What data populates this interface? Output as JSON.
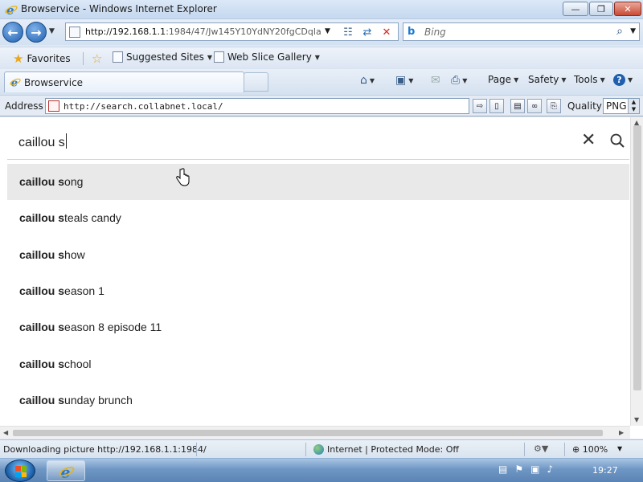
{
  "window": {
    "title": "Browservice - Windows Internet Explorer",
    "min_glyph": "—",
    "max_glyph": "❐",
    "close_glyph": "✕"
  },
  "nav": {
    "url_host": "http://192.168.1.1",
    "url_path": ":1984/47/Jw145Y10YdNY20fgCDqlakur",
    "search_placeholder": "Bing"
  },
  "favorites_bar": {
    "favorites_label": "Favorites",
    "suggested_label": "Suggested Sites",
    "webslice_label": "Web Slice Gallery"
  },
  "tab": {
    "label": "Browservice"
  },
  "commands": {
    "page": "Page",
    "safety": "Safety",
    "tools": "Tools"
  },
  "address": {
    "label": "Address",
    "value": "http://search.collabnet.local/",
    "quality_label": "Quality",
    "quality_value": "PNG"
  },
  "search": {
    "query": "caillou s",
    "suggestions": [
      {
        "bold": "caillou s",
        "rest": "ong"
      },
      {
        "bold": "caillou s",
        "rest": "teals candy"
      },
      {
        "bold": "caillou s",
        "rest": "how"
      },
      {
        "bold": "caillou s",
        "rest": "eason 1"
      },
      {
        "bold": "caillou s",
        "rest": "eason 8 episode 11"
      },
      {
        "bold": "caillou s",
        "rest": "chool"
      },
      {
        "bold": "caillou s",
        "rest": "unday brunch"
      }
    ]
  },
  "status": {
    "text": "Downloading picture http://192.168.1.1:1984/",
    "zone": "Internet | Protected Mode: Off",
    "zoom": "100%"
  },
  "taskbar": {
    "clock": "19:27"
  }
}
